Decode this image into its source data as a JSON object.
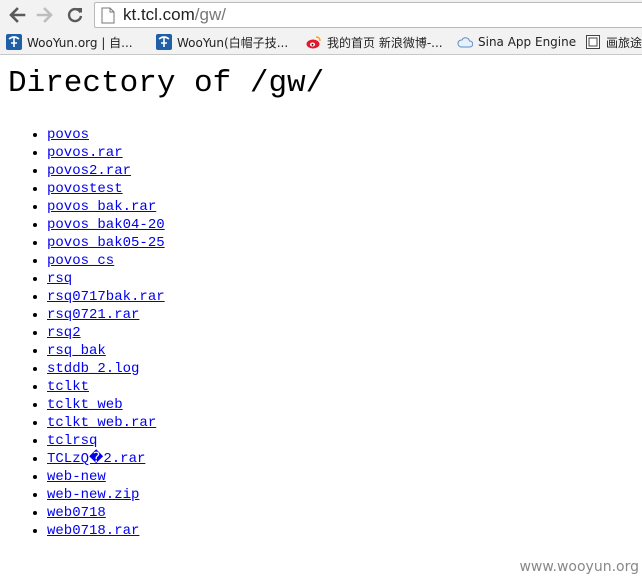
{
  "browser": {
    "back_icon": "arrow-left-icon",
    "forward_icon": "arrow-right-icon",
    "reload_icon": "reload-icon",
    "address": {
      "host": "kt.tcl.com",
      "path": "/gw/"
    },
    "bookmarks": [
      {
        "label": "WooYun.org | 自...",
        "icon": "wooyun-icon"
      },
      {
        "label": "WooYun(白帽子技...",
        "icon": "wooyun-icon"
      },
      {
        "label": "我的首页 新浪微博-...",
        "icon": "weibo-icon"
      },
      {
        "label": "Sina App Engine",
        "icon": "cloud-icon"
      },
      {
        "label": "画旅途",
        "icon": "page-icon"
      }
    ]
  },
  "page": {
    "title": "Directory of /gw/",
    "entries": [
      "povos",
      "povos.rar",
      "povos2.rar",
      "povostest",
      "povos_bak.rar",
      "povos_bak04-20",
      "povos_bak05-25",
      "povos_cs",
      "rsq",
      "rsq0717bak.rar",
      "rsq0721.rar",
      "rsq2",
      "rsq_bak",
      "stddb_2.log",
      "tclkt",
      "tclkt_web",
      "tclkt_web.rar",
      "tclrsq",
      "TCLzQ�2.rar",
      "web-new",
      "web-new.zip",
      "web0718",
      "web0718.rar"
    ]
  },
  "watermark": "www.wooyun.org"
}
